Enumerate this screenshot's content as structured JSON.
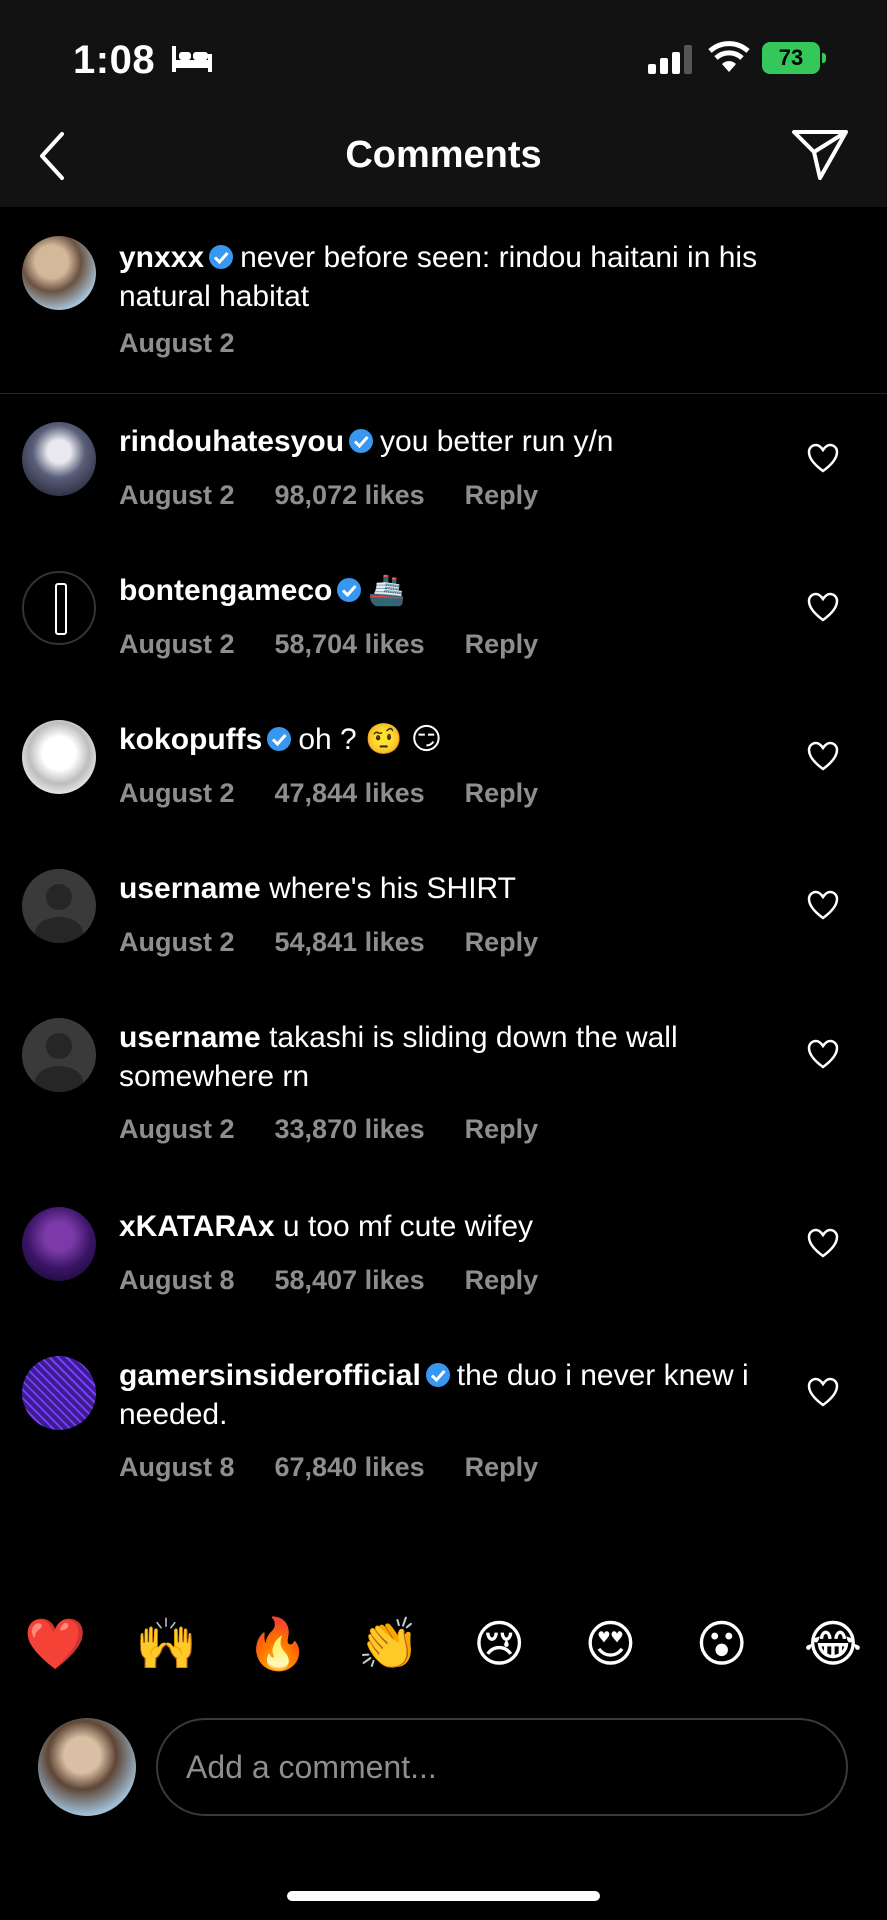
{
  "status_bar": {
    "time": "1:08",
    "battery": "73"
  },
  "header": {
    "title": "Comments"
  },
  "caption": {
    "username": "ynxxx",
    "verified": true,
    "text": "never before seen: rindou haitani in his natural habitat",
    "date": "August 2"
  },
  "comments": [
    {
      "username": "rindouhatesyou",
      "verified": true,
      "text": "you better run y/n",
      "date": "August 2",
      "likes": "98,072 likes",
      "reply": "Reply"
    },
    {
      "username": "bontengameco",
      "verified": true,
      "text": "🚢",
      "date": "August 2",
      "likes": "58,704 likes",
      "reply": "Reply"
    },
    {
      "username": "kokopuffs",
      "verified": true,
      "text": "oh ? 🤨 😏",
      "date": "August 2",
      "likes": "47,844 likes",
      "reply": "Reply"
    },
    {
      "username": "username",
      "verified": false,
      "text": "where's his SHIRT",
      "date": "August 2",
      "likes": "54,841 likes",
      "reply": "Reply"
    },
    {
      "username": "username",
      "verified": false,
      "text": "takashi is sliding down the wall somewhere rn",
      "date": "August 2",
      "likes": "33,870 likes",
      "reply": "Reply"
    },
    {
      "username": "xKATARAx",
      "verified": false,
      "text": "u too mf cute wifey",
      "date": "August 8",
      "likes": "58,407 likes",
      "reply": "Reply"
    },
    {
      "username": "gamersinsiderofficial",
      "verified": true,
      "text": "the duo i never knew i needed.",
      "date": "August 8",
      "likes": "67,840 likes",
      "reply": "Reply"
    }
  ],
  "emoji_reactions": [
    "❤️",
    "🙌",
    "🔥",
    "👏",
    "😢",
    "😍",
    "😮",
    "😂"
  ],
  "comment_input": {
    "placeholder": "Add a comment..."
  },
  "colors": {
    "background": "#000000",
    "header": "#121212",
    "muted": "#8e8e8e",
    "verified": "#3897f0",
    "battery": "#34c759"
  }
}
